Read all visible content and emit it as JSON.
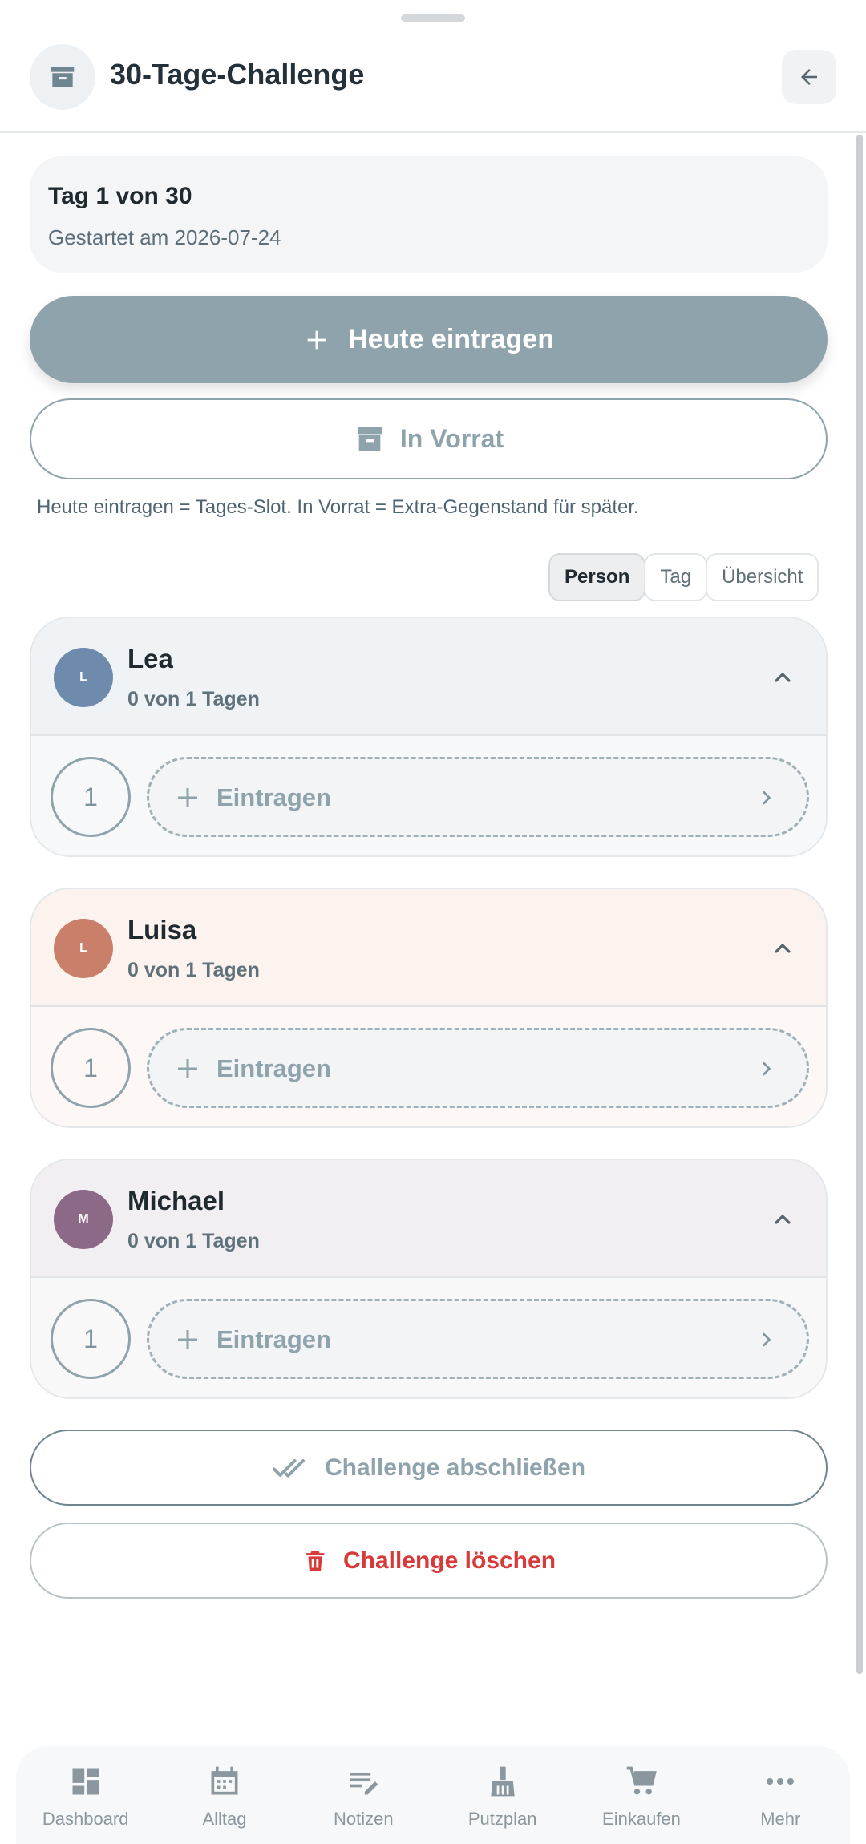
{
  "header": {
    "title": "30-Tage-Challenge",
    "icon": "archive-box-icon",
    "back_icon": "arrow-left-icon"
  },
  "day_card": {
    "title": "Tag 1 von 30",
    "started": "Gestartet am 2026-07-24"
  },
  "actions": {
    "primary_label": "Heute eintragen",
    "secondary_label": "In Vorrat",
    "hint": "Heute eintragen = Tages-Slot. In Vorrat = Extra-Gegenstand für später."
  },
  "view_toggle": {
    "options": [
      "Person",
      "Tag",
      "Übersicht"
    ],
    "selected": "Person"
  },
  "people": [
    {
      "name": "Lea",
      "initial": "L",
      "progress": "0 von 1 Tagen",
      "slot_number": "1",
      "slot_label": "Eintragen",
      "avatar_color": "#6e8aac",
      "head_bg": "#eff3f6",
      "body_bg": "#f6f8fa"
    },
    {
      "name": "Luisa",
      "initial": "L",
      "progress": "0 von 1 Tagen",
      "slot_number": "1",
      "slot_label": "Eintragen",
      "avatar_color": "#c97f6a",
      "head_bg": "#fcf2ee",
      "body_bg": "#fdf8f6"
    },
    {
      "name": "Michael",
      "initial": "M",
      "progress": "0 von 1 Tagen",
      "slot_number": "1",
      "slot_label": "Eintragen",
      "avatar_color": "#8c6987",
      "head_bg": "#f2eff2",
      "body_bg": "#f8f8f9"
    }
  ],
  "footer_actions": {
    "finish_label": "Challenge abschließen",
    "delete_label": "Challenge löschen"
  },
  "bottom_nav": [
    {
      "label": "Dashboard",
      "icon": "dashboard-icon"
    },
    {
      "label": "Alltag",
      "icon": "calendar-icon"
    },
    {
      "label": "Notizen",
      "icon": "notes-icon"
    },
    {
      "label": "Putzplan",
      "icon": "broom-icon"
    },
    {
      "label": "Einkaufen",
      "icon": "cart-icon"
    },
    {
      "label": "Mehr",
      "icon": "more-icon"
    }
  ],
  "colors": {
    "accent": "#8ea3ac",
    "danger": "#d83a3a"
  }
}
